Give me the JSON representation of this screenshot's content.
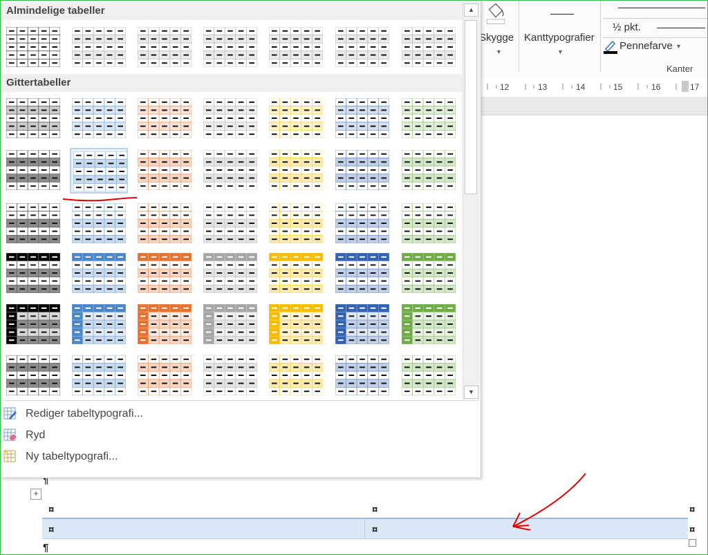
{
  "gallery": {
    "section_plain": "Almindelige tabeller",
    "section_grid": "Gittertabeller",
    "colors": {
      "black": "#000000",
      "blue": "#4a86c8",
      "orange": "#e67230",
      "gray": "#a5a5a5",
      "gold": "#f5bc00",
      "darkblue": "#3262b0",
      "green": "#6fac46"
    }
  },
  "menu": {
    "edit": "Rediger tabeltypografi...",
    "clear": "Ryd",
    "new": "Ny tabeltypografi..."
  },
  "ribbon": {
    "shading_label": "Skygge",
    "border_styles_label": "Kanttypografier",
    "line_weight": "½ pkt.",
    "pen_color_label": "Pennefarve",
    "group_label": "Kanter",
    "ruler_ticks": [
      "12",
      "13",
      "14",
      "15",
      "16",
      "17"
    ]
  },
  "document": {
    "pilcrow": "¶",
    "cell_mark": "¤",
    "move_handle": "+"
  }
}
